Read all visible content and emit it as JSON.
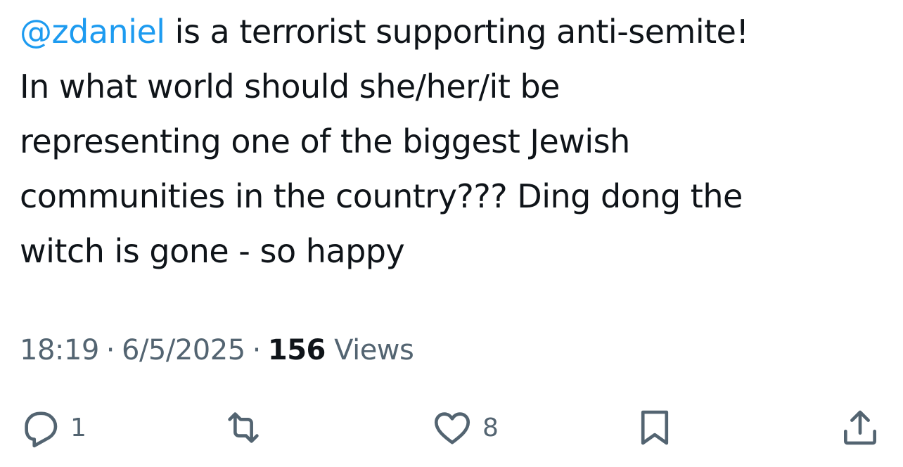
{
  "tweet": {
    "mention": "@zdaniel",
    "line1_rest": " is a terrorist supporting anti-semite!",
    "line2": "In what world should she/her/it be",
    "line3": "representing one of the biggest Jewish",
    "line4": "communities in the country??? Ding dong the",
    "line5": "witch is gone - so happy"
  },
  "meta": {
    "time": "18:19",
    "separator": "·",
    "date": "6/5/2025",
    "views_count": "156",
    "views_label": "Views"
  },
  "actions": {
    "reply_icon": "reply-bubble-icon",
    "reply_count": "1",
    "retweet_icon": "retweet-icon",
    "like_icon": "heart-icon",
    "like_count": "8",
    "bookmark_icon": "bookmark-icon",
    "share_icon": "share-upload-icon"
  },
  "colors": {
    "text": "#0f1419",
    "secondary": "#536471",
    "mention": "#1d9bf0",
    "background": "#ffffff"
  }
}
